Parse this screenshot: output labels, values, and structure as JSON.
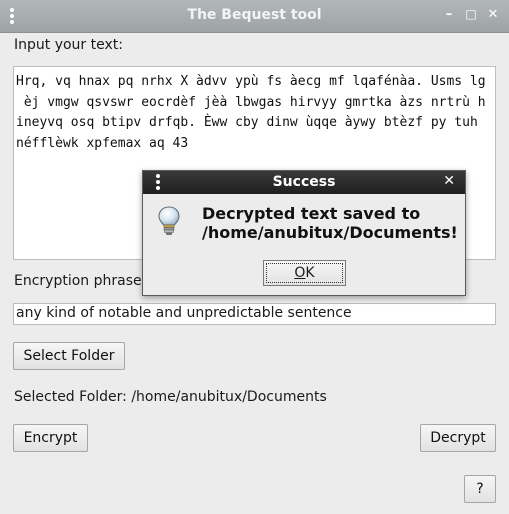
{
  "window": {
    "title": "The Bequest tool",
    "minimize_glyph": "–",
    "maximize_glyph": "□",
    "close_glyph": "✕"
  },
  "input_label": "Input your text:",
  "input_text_lines": [
    "Hrq, vq hnax pq nrhx X àdvv ypù fs àecg mf lqafénàa. Usms lg",
    " èj vmgw qsvswr eocrdèf jèà lbwgas hirvyy gmrtka àzs nrtrù h",
    "ineyvq osq btipv drfqb. Èww cby dinw ùqqe àywy btèzf py tuh",
    "néfflèwk xpfemax aq 43"
  ],
  "encryption_label": "Encryption phrase:",
  "encryption_value": "any kind of notable and unpredictable sentence",
  "select_folder_button": "Select Folder",
  "selected_folder_text": "Selected Folder: /home/anubitux/Documents",
  "encrypt_button": "Encrypt",
  "decrypt_button": "Decrypt",
  "help_button": "?",
  "dialog": {
    "title": "Success",
    "close_glyph": "✕",
    "message_line1": "Decrypted text saved to",
    "message_line2": "/home/anubitux/Documents!",
    "ok_first": "O",
    "ok_rest": "K",
    "icon": "lightbulb-icon"
  }
}
